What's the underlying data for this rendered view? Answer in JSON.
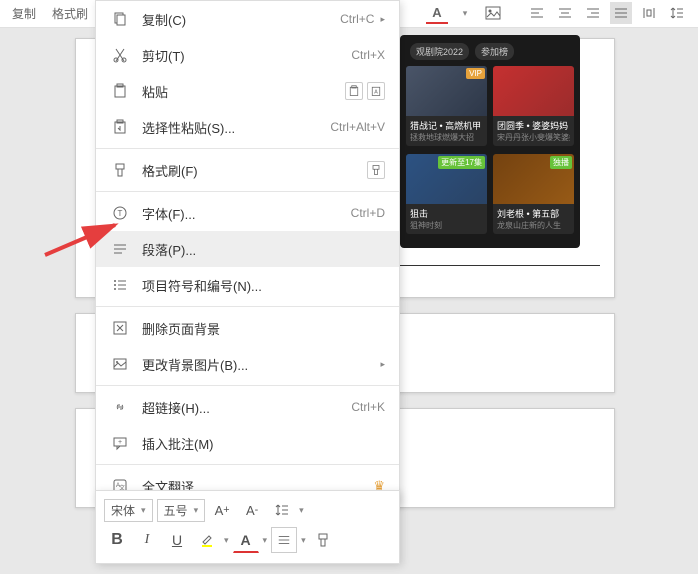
{
  "toolbar": {
    "tabs": [
      "复制",
      "格式刷"
    ]
  },
  "right_toolbar": {
    "font_color_icon": "A",
    "align_icons": true
  },
  "menu": {
    "items": [
      {
        "icon": "copy",
        "label": "复制(C)",
        "shortcut": "Ctrl+C",
        "arrow": true
      },
      {
        "icon": "cut",
        "label": "剪切(T)",
        "shortcut": "Ctrl+X"
      },
      {
        "icon": "paste",
        "label": "粘贴",
        "shortcut": "",
        "extra": true
      },
      {
        "icon": "paste-special",
        "label": "选择性粘贴(S)...",
        "shortcut": "Ctrl+Alt+V"
      },
      {
        "divider": true
      },
      {
        "icon": "format-brush",
        "label": "格式刷(F)",
        "shortcut": "",
        "extra_single": true
      },
      {
        "divider": true
      },
      {
        "icon": "font",
        "label": "字体(F)...",
        "shortcut": "Ctrl+D"
      },
      {
        "icon": "paragraph",
        "label": "段落(P)...",
        "shortcut": "",
        "highlighted": true
      },
      {
        "icon": "bullets",
        "label": "项目符号和编号(N)...",
        "shortcut": ""
      },
      {
        "divider": true
      },
      {
        "icon": "delete-bg",
        "label": "删除页面背景",
        "shortcut": ""
      },
      {
        "icon": "change-bg",
        "label": "更改背景图片(B)...",
        "shortcut": "",
        "arrow": true
      },
      {
        "divider": true
      },
      {
        "icon": "link",
        "label": "超链接(H)...",
        "shortcut": "Ctrl+K"
      },
      {
        "icon": "comment",
        "label": "插入批注(M)",
        "shortcut": ""
      },
      {
        "divider": true
      },
      {
        "icon": "translate",
        "label": "全文翻译",
        "shortcut": "",
        "crown": true
      }
    ]
  },
  "media": {
    "top_tags": [
      "观剧院2022",
      "参加榜"
    ],
    "cards": [
      {
        "title": "猎战记 • 高燃机甲",
        "sub": "拯救地球燃爆大招",
        "badge": "VIP"
      },
      {
        "title": "团圆季 • 婆婆妈妈",
        "sub": "宋丹丹张小斐爆笑婆媳",
        "badge": ""
      },
      {
        "title": "狙击",
        "sub": "狙神时刻",
        "badge": "更新至17集"
      },
      {
        "title": "刘老根 • 第五部",
        "sub": "龙泉山庄新的人生",
        "badge": "独播"
      }
    ]
  },
  "bottom_toolbar": {
    "font_name": "宋体",
    "font_size": "五号",
    "bold": "B",
    "italic": "I",
    "underline": "U"
  }
}
